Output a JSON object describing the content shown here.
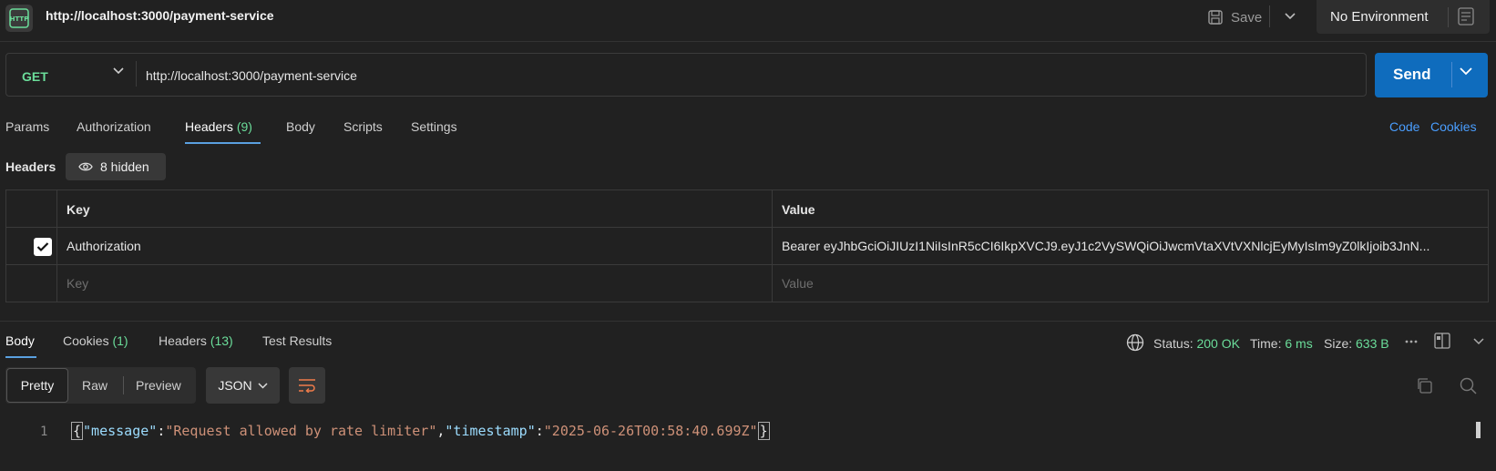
{
  "tab": {
    "icon": "http-request-icon",
    "title": "http://localhost:3000/payment-service"
  },
  "toolbar": {
    "save_label": "Save",
    "environment": "No Environment"
  },
  "request": {
    "method": "GET",
    "url": "http://localhost:3000/payment-service",
    "send_label": "Send"
  },
  "request_tabs": [
    {
      "label": "Params"
    },
    {
      "label": "Authorization"
    },
    {
      "label": "Headers",
      "count": "(9)"
    },
    {
      "label": "Body"
    },
    {
      "label": "Scripts"
    },
    {
      "label": "Settings"
    }
  ],
  "links": {
    "code": "Code",
    "cookies": "Cookies"
  },
  "headers_section": {
    "label": "Headers",
    "hidden_label": "8 hidden",
    "columns": [
      "Key",
      "Value"
    ],
    "rows": [
      {
        "checked": true,
        "key": "Authorization",
        "value": "Bearer eyJhbGciOiJIUzI1NiIsInR5cCI6IkpXVCJ9.eyJ1c2VySWQiOiJwcmVtaXVtVXNlcjEyMyIsIm9yZ0lkIjoib3JnN..."
      }
    ],
    "placeholder": {
      "key": "Key",
      "value": "Value"
    }
  },
  "response_tabs": [
    {
      "label": "Body"
    },
    {
      "label": "Cookies",
      "count": "(1)"
    },
    {
      "label": "Headers",
      "count": "(13)"
    },
    {
      "label": "Test Results"
    }
  ],
  "response_status": {
    "status_label": "Status:",
    "status": "200 OK",
    "time_label": "Time:",
    "time": "6 ms",
    "size_label": "Size:",
    "size": "633 B"
  },
  "response_view": {
    "modes": [
      "Pretty",
      "Raw",
      "Preview"
    ],
    "format": "JSON"
  },
  "response_body": {
    "line_number": "1",
    "open_brace": "{",
    "close_brace": "}",
    "k1": "\"message\"",
    "v1": "\"Request allowed by rate limiter\"",
    "k2": "\"timestamp\"",
    "v2": "\"2025-06-26T00:58:40.699Z\"",
    "colon": ":",
    "comma": ","
  },
  "colors": {
    "accent": "#0f6cbd",
    "success": "#6bdd9a",
    "link": "#4a9eff",
    "background": "#212121"
  }
}
